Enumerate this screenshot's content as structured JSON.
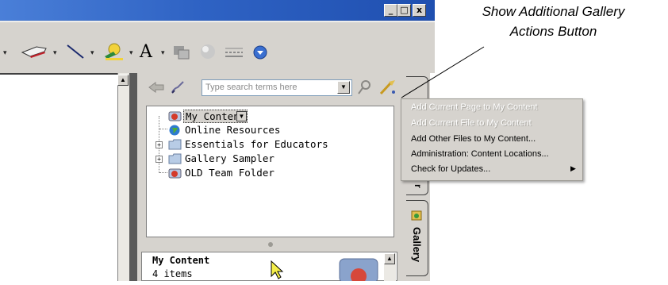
{
  "window": {
    "buttons": [
      "_",
      "□",
      "x"
    ]
  },
  "toolbar": {
    "icons": [
      "shape-eraser-icon",
      "line-icon",
      "fill-color-icon",
      "font-color-icon",
      "arrange-icon",
      "3d-effects-icon",
      "line-style-icon",
      "download-icon"
    ]
  },
  "search": {
    "placeholder": "Type search terms here"
  },
  "tree": {
    "items": [
      {
        "label": "My Content",
        "selected": true
      },
      {
        "label": "Online Resources",
        "selected": false
      },
      {
        "label": "Essentials for Educators",
        "expandable": true
      },
      {
        "label": "Gallery Sampler",
        "expandable": true
      },
      {
        "label": "OLD Team Folder",
        "selected": false
      }
    ]
  },
  "details": {
    "title": "My Content",
    "count": "4 items"
  },
  "tabs": {
    "gallery_label": "Gallery",
    "partial_label": "r"
  },
  "context_menu": {
    "items": [
      {
        "label": "Add Current Page to My Content",
        "enabled": false
      },
      {
        "label": "Add Current File to My Content",
        "enabled": false
      },
      {
        "label": "Add Other Files to My Content...",
        "enabled": true
      },
      {
        "label": "Administration: Content Locations...",
        "enabled": true
      },
      {
        "label": "Check for Updates...",
        "enabled": true,
        "submenu": true
      }
    ]
  },
  "callout": {
    "line1": "Show Additional Gallery",
    "line2": "Actions Button"
  },
  "colors": {
    "titlebar": "#2f63c4",
    "chrome": "#d6d3ce",
    "disabled_text": "#ffffff"
  }
}
